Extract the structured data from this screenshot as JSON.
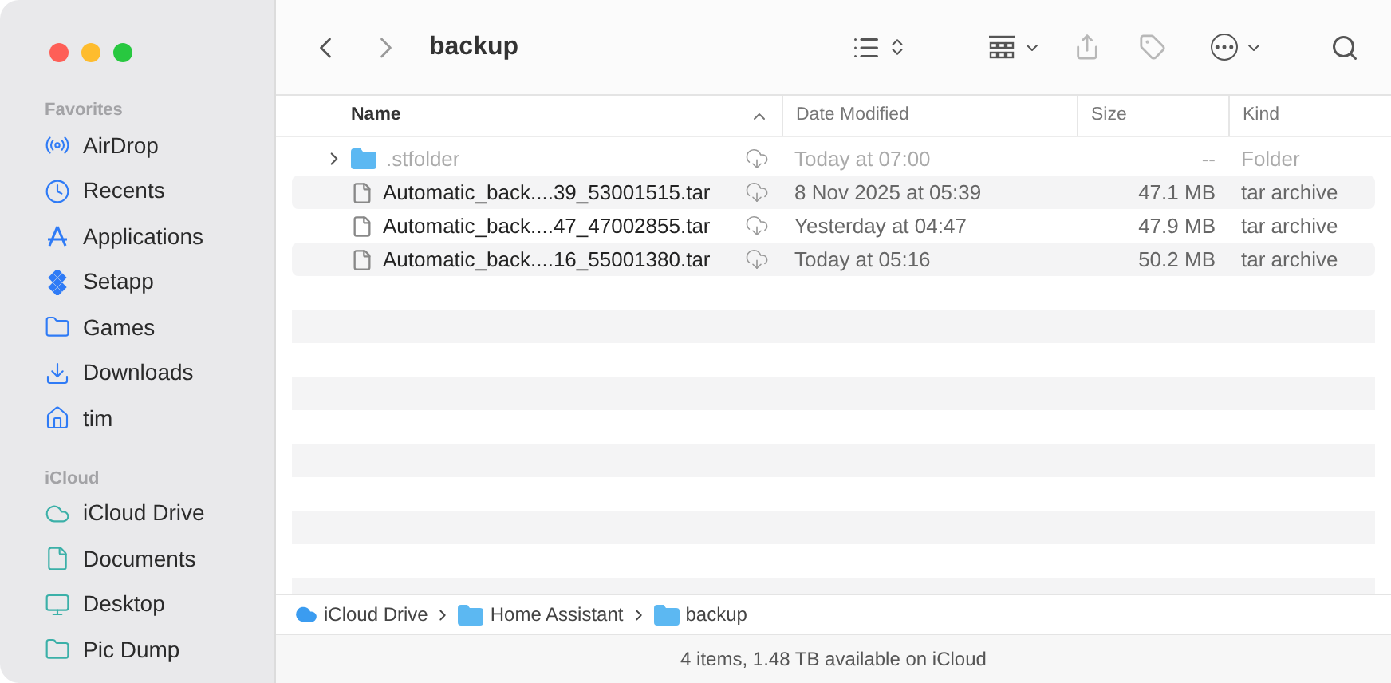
{
  "window": {
    "title": "backup"
  },
  "sidebar": {
    "sections": [
      {
        "heading": "Favorites",
        "items": [
          "AirDrop",
          "Recents",
          "Applications",
          "Setapp",
          "Games",
          "Downloads",
          "tim"
        ]
      },
      {
        "heading": "iCloud",
        "items": [
          "iCloud Drive",
          "Documents",
          "Desktop",
          "Pic Dump"
        ]
      }
    ]
  },
  "table": {
    "columns": [
      {
        "label": "Name",
        "sorted": true
      },
      {
        "label": "Date Modified",
        "sorted": false
      },
      {
        "label": "Size",
        "sorted": false
      },
      {
        "label": "Kind",
        "sorted": false
      }
    ],
    "rows": [
      {
        "kind": "folder",
        "dimmed": true,
        "name": ".stfolder",
        "date": "Today at 07:00",
        "size": "--",
        "type": "Folder"
      },
      {
        "kind": "file",
        "dimmed": false,
        "name": "Automatic_back....39_53001515.tar",
        "date": "8 Nov 2025 at 05:39",
        "size": "47.1 MB",
        "type": "tar archive"
      },
      {
        "kind": "file",
        "dimmed": false,
        "name": "Automatic_back....47_47002855.tar",
        "date": "Yesterday at 04:47",
        "size": "47.9 MB",
        "type": "tar archive"
      },
      {
        "kind": "file",
        "dimmed": false,
        "name": "Automatic_back....16_55001380.tar",
        "date": "Today at 05:16",
        "size": "50.2 MB",
        "type": "tar archive"
      }
    ]
  },
  "path_bar": [
    "iCloud Drive",
    "Home Assistant",
    "backup"
  ],
  "status_bar": "4 items, 1.48 TB available on iCloud"
}
